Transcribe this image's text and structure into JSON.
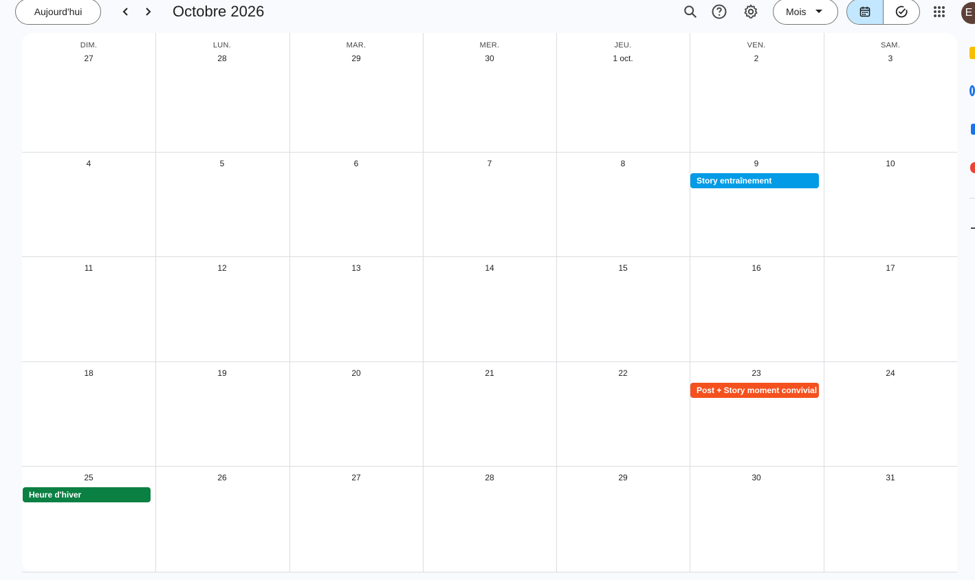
{
  "header": {
    "today_label": "Aujourd'hui",
    "month_title": "Octobre 2026",
    "view_label": "Mois",
    "avatar_initial": "E"
  },
  "icons": {
    "prev": "chevron-left-icon",
    "next": "chevron-right-icon",
    "search": "search-icon",
    "help": "help-icon",
    "settings": "gear-icon",
    "calendar_view": "calendar-icon",
    "tasks_view": "check-circle-icon",
    "apps": "apps-grid-icon"
  },
  "calendar": {
    "weekdays": [
      "DIM.",
      "LUN.",
      "MAR.",
      "MER.",
      "JEU.",
      "VEN.",
      "SAM."
    ],
    "weeks": [
      [
        "27",
        "28",
        "29",
        "30",
        "1 oct.",
        "2",
        "3"
      ],
      [
        "4",
        "5",
        "6",
        "7",
        "8",
        "9",
        "10"
      ],
      [
        "11",
        "12",
        "13",
        "14",
        "15",
        "16",
        "17"
      ],
      [
        "18",
        "19",
        "20",
        "21",
        "22",
        "23",
        "24"
      ],
      [
        "25",
        "26",
        "27",
        "28",
        "29",
        "30",
        "31"
      ]
    ],
    "events": [
      {
        "title": "Story entraînement",
        "date": "9",
        "color": "#039be5"
      },
      {
        "title": "Post + Story moment convivial",
        "date": "23",
        "color": "#f4511e"
      },
      {
        "title": "Heure d'hiver",
        "date": "25",
        "color": "#0b8043"
      }
    ]
  },
  "colors": {
    "accent": "#c2e7ff",
    "border": "#dadce0"
  }
}
